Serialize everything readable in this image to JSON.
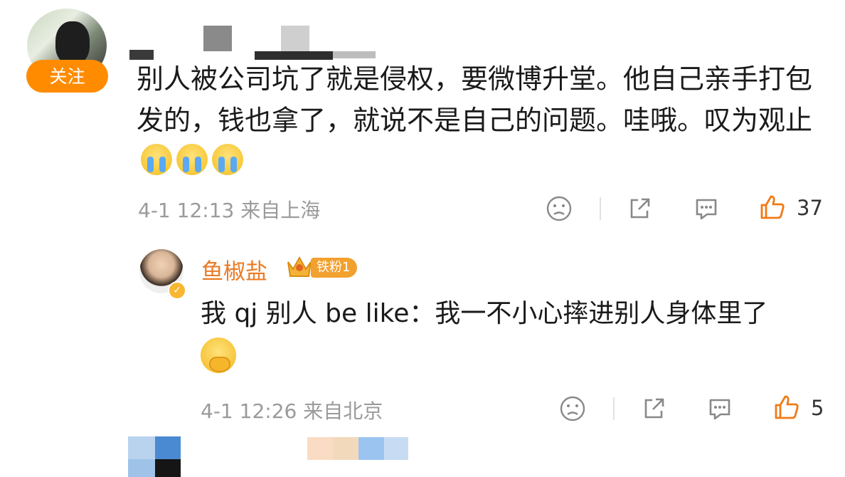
{
  "comment": {
    "follow_label": "关注",
    "text": "别人被公司坑了就是侵权，要微博升堂。他自己亲手打包发的，钱也拿了，就说不是自己的问题。哇哦。叹为观止",
    "emojis": [
      "crying-face",
      "crying-face",
      "crying-face"
    ],
    "date": "4-1 12:13",
    "location": "来自上海",
    "like_count": "37"
  },
  "reply": {
    "username": "鱼椒盐",
    "fan_badge": "铁粉1",
    "text": "我 qj 别人 be like：我一不小心摔进别人身体里了",
    "emoji": "fearful-face-covering-mouth",
    "date": "4-1 12:26",
    "location": "来自北京",
    "like_count": "5"
  },
  "colors": {
    "accent_orange": "#ff8c00",
    "name_orange": "#eb7a24",
    "meta_gray": "#9a9a9a"
  }
}
